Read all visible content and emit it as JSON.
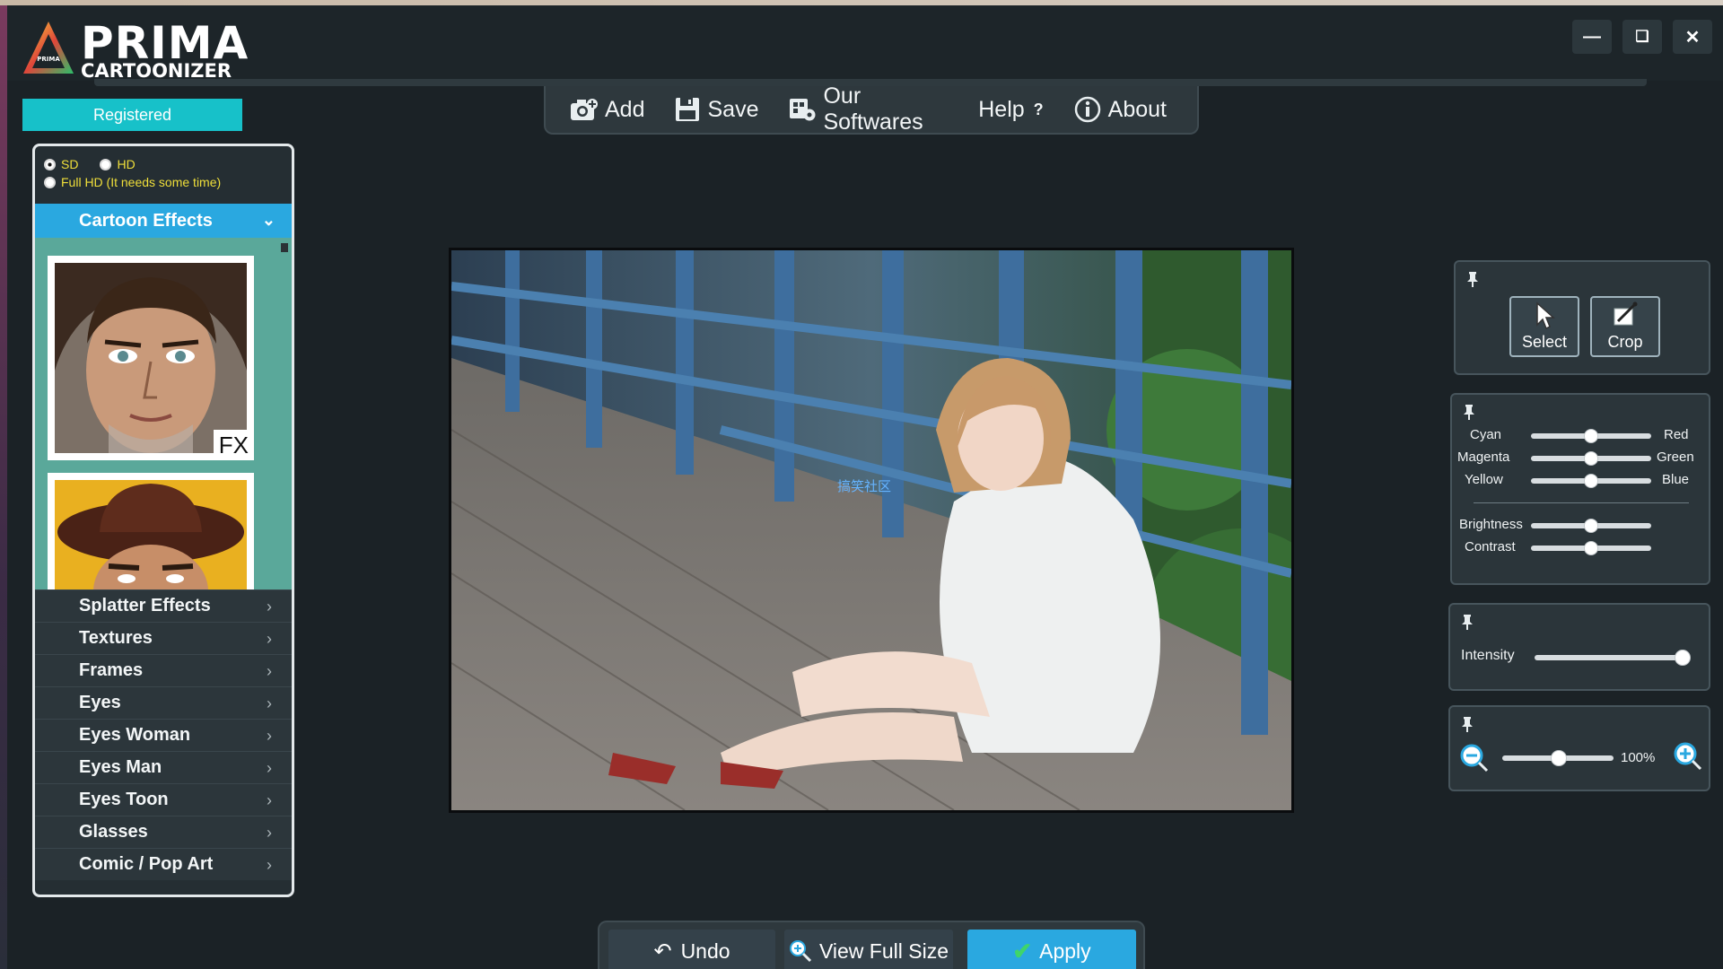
{
  "app": {
    "logo_line1": "PRIMA",
    "logo_line2": "CARTOONIZER",
    "logo_badge": "PRIMA"
  },
  "window_controls": [
    "minimize",
    "restore",
    "close"
  ],
  "registration": {
    "label": "Registered"
  },
  "menu": {
    "add": "Add",
    "save": "Save",
    "our_softwares": "Our Softwares",
    "help": "Help",
    "help_mark": "?",
    "about": "About"
  },
  "quality": {
    "sd": "SD",
    "hd": "HD",
    "fullhd": "Full HD (It needs some time)",
    "selected": "SD"
  },
  "categories": {
    "active": "Cartoon Effects",
    "thumb_badge": "FX",
    "items": [
      "Splatter Effects",
      "Textures",
      "Frames",
      "Eyes",
      "Eyes Woman",
      "Eyes Man",
      "Eyes Toon",
      "Glasses",
      "Comic / Pop Art"
    ]
  },
  "canvas": {
    "watermark": "搞笑社区"
  },
  "tools": {
    "select": "Select",
    "crop": "Crop"
  },
  "color_balance": {
    "cyan": "Cyan",
    "red": "Red",
    "magenta": "Magenta",
    "green": "Green",
    "yellow": "Yellow",
    "blue": "Blue",
    "brightness": "Brightness",
    "contrast": "Contrast",
    "levels": {
      "cyan_red": 0.5,
      "magenta_green": 0.5,
      "yellow_blue": 0.5,
      "brightness": 0.5,
      "contrast": 0.5
    }
  },
  "intensity": {
    "label": "Intensity",
    "level": 1.0
  },
  "zoom": {
    "value": "100%",
    "level": 0.48
  },
  "bottom": {
    "undo": "Undo",
    "view_full_size": "View Full Size",
    "apply": "Apply"
  },
  "colors": {
    "accent_cyan": "#17c1c9",
    "accent_blue": "#2aa8e0",
    "quality_text": "#f0df3a",
    "background": "#1b2226"
  }
}
